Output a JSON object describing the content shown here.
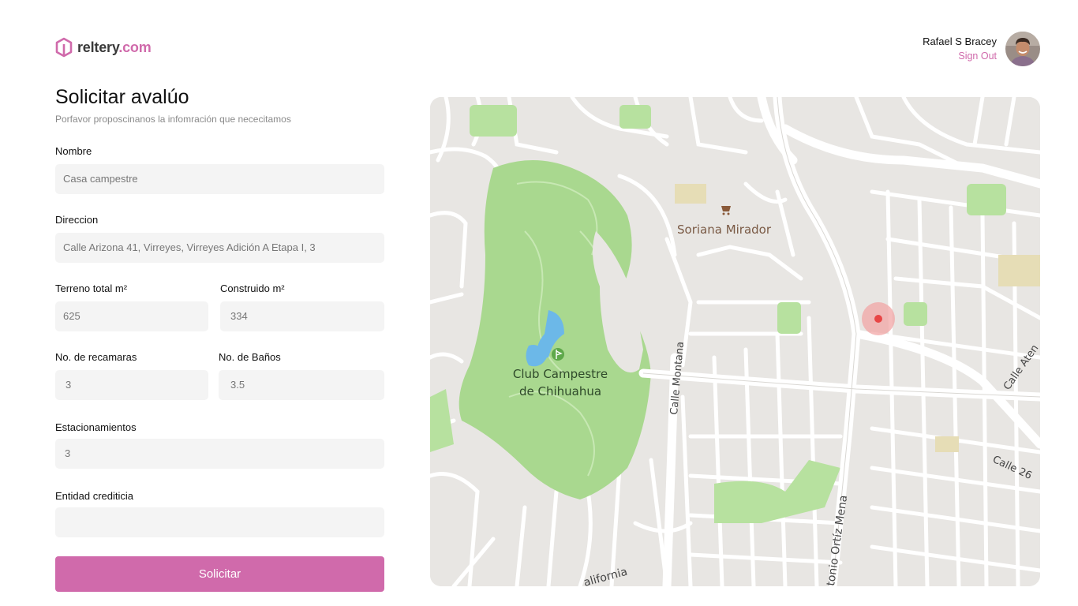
{
  "brand": {
    "name": "reltery",
    "tld": ".com",
    "accent": "#d06aab"
  },
  "user": {
    "name": "Rafael S Bracey",
    "signout_label": "Sign Out"
  },
  "form": {
    "title": "Solicitar avalúo",
    "subtitle": "Porfavor proposcinanos la infomración que nececitamos",
    "fields": {
      "nombre": {
        "label": "Nombre",
        "value": "Casa campestre"
      },
      "direccion": {
        "label": "Direccion",
        "value": "Calle Arizona 41, Virreyes, Virreyes Adición A Etapa I, 3"
      },
      "terreno": {
        "label": "Terreno total m²",
        "value": "625"
      },
      "construido": {
        "label": "Construido m²",
        "value": "334"
      },
      "recamaras": {
        "label": "No. de recamaras",
        "value": "3"
      },
      "banos": {
        "label": "No. de Baños",
        "value": "3.5"
      },
      "estacionamientos": {
        "label": "Estacionamientos",
        "value": "3"
      },
      "entidad": {
        "label": "Entidad crediticia",
        "value": ""
      }
    },
    "submit_label": "Solicitar"
  },
  "map": {
    "labels": {
      "store": "Soriana Mirador",
      "club_line1": "Club Campestre",
      "club_line2": "de Chihuahua",
      "street_montana": "Calle Montana",
      "street_ortiz": "tonio Ortíz Mena",
      "street_california": "alifornia",
      "street_26": "Calle 26",
      "street_aten": "Calle Aten"
    }
  }
}
